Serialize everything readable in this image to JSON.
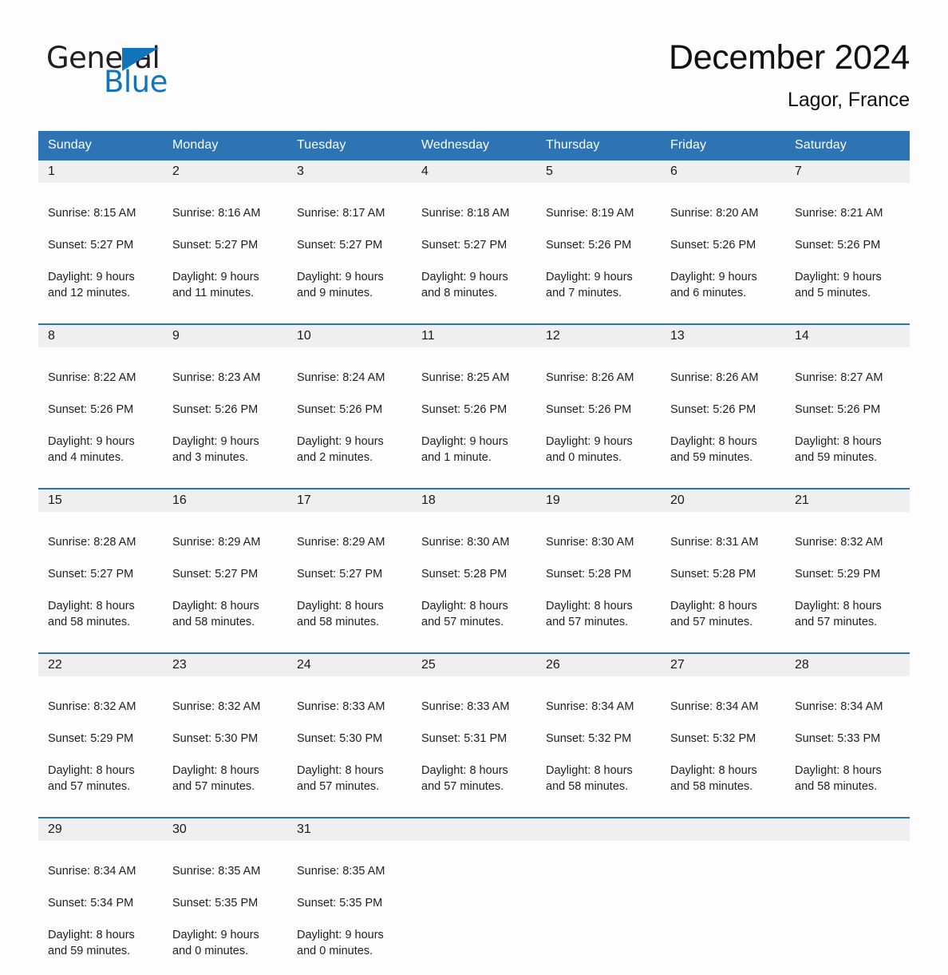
{
  "brand": {
    "name_part1": "General",
    "name_part2": "Blue",
    "accent_color": "#1274ba"
  },
  "header": {
    "title": "December 2024",
    "subtitle": "Lagor, France"
  },
  "calendar": {
    "header_bg_color": "#2e74b5",
    "daynum_bg_color": "#efefef",
    "weekday_headers": [
      "Sunday",
      "Monday",
      "Tuesday",
      "Wednesday",
      "Thursday",
      "Friday",
      "Saturday"
    ],
    "weeks": [
      [
        {
          "day": "1",
          "sunrise": "Sunrise: 8:15 AM",
          "sunset": "Sunset: 5:27 PM",
          "daylight": "Daylight: 9 hours\nand 12 minutes."
        },
        {
          "day": "2",
          "sunrise": "Sunrise: 8:16 AM",
          "sunset": "Sunset: 5:27 PM",
          "daylight": "Daylight: 9 hours\nand 11 minutes."
        },
        {
          "day": "3",
          "sunrise": "Sunrise: 8:17 AM",
          "sunset": "Sunset: 5:27 PM",
          "daylight": "Daylight: 9 hours\nand 9 minutes."
        },
        {
          "day": "4",
          "sunrise": "Sunrise: 8:18 AM",
          "sunset": "Sunset: 5:27 PM",
          "daylight": "Daylight: 9 hours\nand 8 minutes."
        },
        {
          "day": "5",
          "sunrise": "Sunrise: 8:19 AM",
          "sunset": "Sunset: 5:26 PM",
          "daylight": "Daylight: 9 hours\nand 7 minutes."
        },
        {
          "day": "6",
          "sunrise": "Sunrise: 8:20 AM",
          "sunset": "Sunset: 5:26 PM",
          "daylight": "Daylight: 9 hours\nand 6 minutes."
        },
        {
          "day": "7",
          "sunrise": "Sunrise: 8:21 AM",
          "sunset": "Sunset: 5:26 PM",
          "daylight": "Daylight: 9 hours\nand 5 minutes."
        }
      ],
      [
        {
          "day": "8",
          "sunrise": "Sunrise: 8:22 AM",
          "sunset": "Sunset: 5:26 PM",
          "daylight": "Daylight: 9 hours\nand 4 minutes."
        },
        {
          "day": "9",
          "sunrise": "Sunrise: 8:23 AM",
          "sunset": "Sunset: 5:26 PM",
          "daylight": "Daylight: 9 hours\nand 3 minutes."
        },
        {
          "day": "10",
          "sunrise": "Sunrise: 8:24 AM",
          "sunset": "Sunset: 5:26 PM",
          "daylight": "Daylight: 9 hours\nand 2 minutes."
        },
        {
          "day": "11",
          "sunrise": "Sunrise: 8:25 AM",
          "sunset": "Sunset: 5:26 PM",
          "daylight": "Daylight: 9 hours\nand 1 minute."
        },
        {
          "day": "12",
          "sunrise": "Sunrise: 8:26 AM",
          "sunset": "Sunset: 5:26 PM",
          "daylight": "Daylight: 9 hours\nand 0 minutes."
        },
        {
          "day": "13",
          "sunrise": "Sunrise: 8:26 AM",
          "sunset": "Sunset: 5:26 PM",
          "daylight": "Daylight: 8 hours\nand 59 minutes."
        },
        {
          "day": "14",
          "sunrise": "Sunrise: 8:27 AM",
          "sunset": "Sunset: 5:26 PM",
          "daylight": "Daylight: 8 hours\nand 59 minutes."
        }
      ],
      [
        {
          "day": "15",
          "sunrise": "Sunrise: 8:28 AM",
          "sunset": "Sunset: 5:27 PM",
          "daylight": "Daylight: 8 hours\nand 58 minutes."
        },
        {
          "day": "16",
          "sunrise": "Sunrise: 8:29 AM",
          "sunset": "Sunset: 5:27 PM",
          "daylight": "Daylight: 8 hours\nand 58 minutes."
        },
        {
          "day": "17",
          "sunrise": "Sunrise: 8:29 AM",
          "sunset": "Sunset: 5:27 PM",
          "daylight": "Daylight: 8 hours\nand 58 minutes."
        },
        {
          "day": "18",
          "sunrise": "Sunrise: 8:30 AM",
          "sunset": "Sunset: 5:28 PM",
          "daylight": "Daylight: 8 hours\nand 57 minutes."
        },
        {
          "day": "19",
          "sunrise": "Sunrise: 8:30 AM",
          "sunset": "Sunset: 5:28 PM",
          "daylight": "Daylight: 8 hours\nand 57 minutes."
        },
        {
          "day": "20",
          "sunrise": "Sunrise: 8:31 AM",
          "sunset": "Sunset: 5:28 PM",
          "daylight": "Daylight: 8 hours\nand 57 minutes."
        },
        {
          "day": "21",
          "sunrise": "Sunrise: 8:32 AM",
          "sunset": "Sunset: 5:29 PM",
          "daylight": "Daylight: 8 hours\nand 57 minutes."
        }
      ],
      [
        {
          "day": "22",
          "sunrise": "Sunrise: 8:32 AM",
          "sunset": "Sunset: 5:29 PM",
          "daylight": "Daylight: 8 hours\nand 57 minutes."
        },
        {
          "day": "23",
          "sunrise": "Sunrise: 8:32 AM",
          "sunset": "Sunset: 5:30 PM",
          "daylight": "Daylight: 8 hours\nand 57 minutes."
        },
        {
          "day": "24",
          "sunrise": "Sunrise: 8:33 AM",
          "sunset": "Sunset: 5:30 PM",
          "daylight": "Daylight: 8 hours\nand 57 minutes."
        },
        {
          "day": "25",
          "sunrise": "Sunrise: 8:33 AM",
          "sunset": "Sunset: 5:31 PM",
          "daylight": "Daylight: 8 hours\nand 57 minutes."
        },
        {
          "day": "26",
          "sunrise": "Sunrise: 8:34 AM",
          "sunset": "Sunset: 5:32 PM",
          "daylight": "Daylight: 8 hours\nand 58 minutes."
        },
        {
          "day": "27",
          "sunrise": "Sunrise: 8:34 AM",
          "sunset": "Sunset: 5:32 PM",
          "daylight": "Daylight: 8 hours\nand 58 minutes."
        },
        {
          "day": "28",
          "sunrise": "Sunrise: 8:34 AM",
          "sunset": "Sunset: 5:33 PM",
          "daylight": "Daylight: 8 hours\nand 58 minutes."
        }
      ],
      [
        {
          "day": "29",
          "sunrise": "Sunrise: 8:34 AM",
          "sunset": "Sunset: 5:34 PM",
          "daylight": "Daylight: 8 hours\nand 59 minutes."
        },
        {
          "day": "30",
          "sunrise": "Sunrise: 8:35 AM",
          "sunset": "Sunset: 5:35 PM",
          "daylight": "Daylight: 9 hours\nand 0 minutes."
        },
        {
          "day": "31",
          "sunrise": "Sunrise: 8:35 AM",
          "sunset": "Sunset: 5:35 PM",
          "daylight": "Daylight: 9 hours\nand 0 minutes."
        },
        {
          "day": "",
          "sunrise": "",
          "sunset": "",
          "daylight": ""
        },
        {
          "day": "",
          "sunrise": "",
          "sunset": "",
          "daylight": ""
        },
        {
          "day": "",
          "sunrise": "",
          "sunset": "",
          "daylight": ""
        },
        {
          "day": "",
          "sunrise": "",
          "sunset": "",
          "daylight": ""
        }
      ]
    ]
  }
}
